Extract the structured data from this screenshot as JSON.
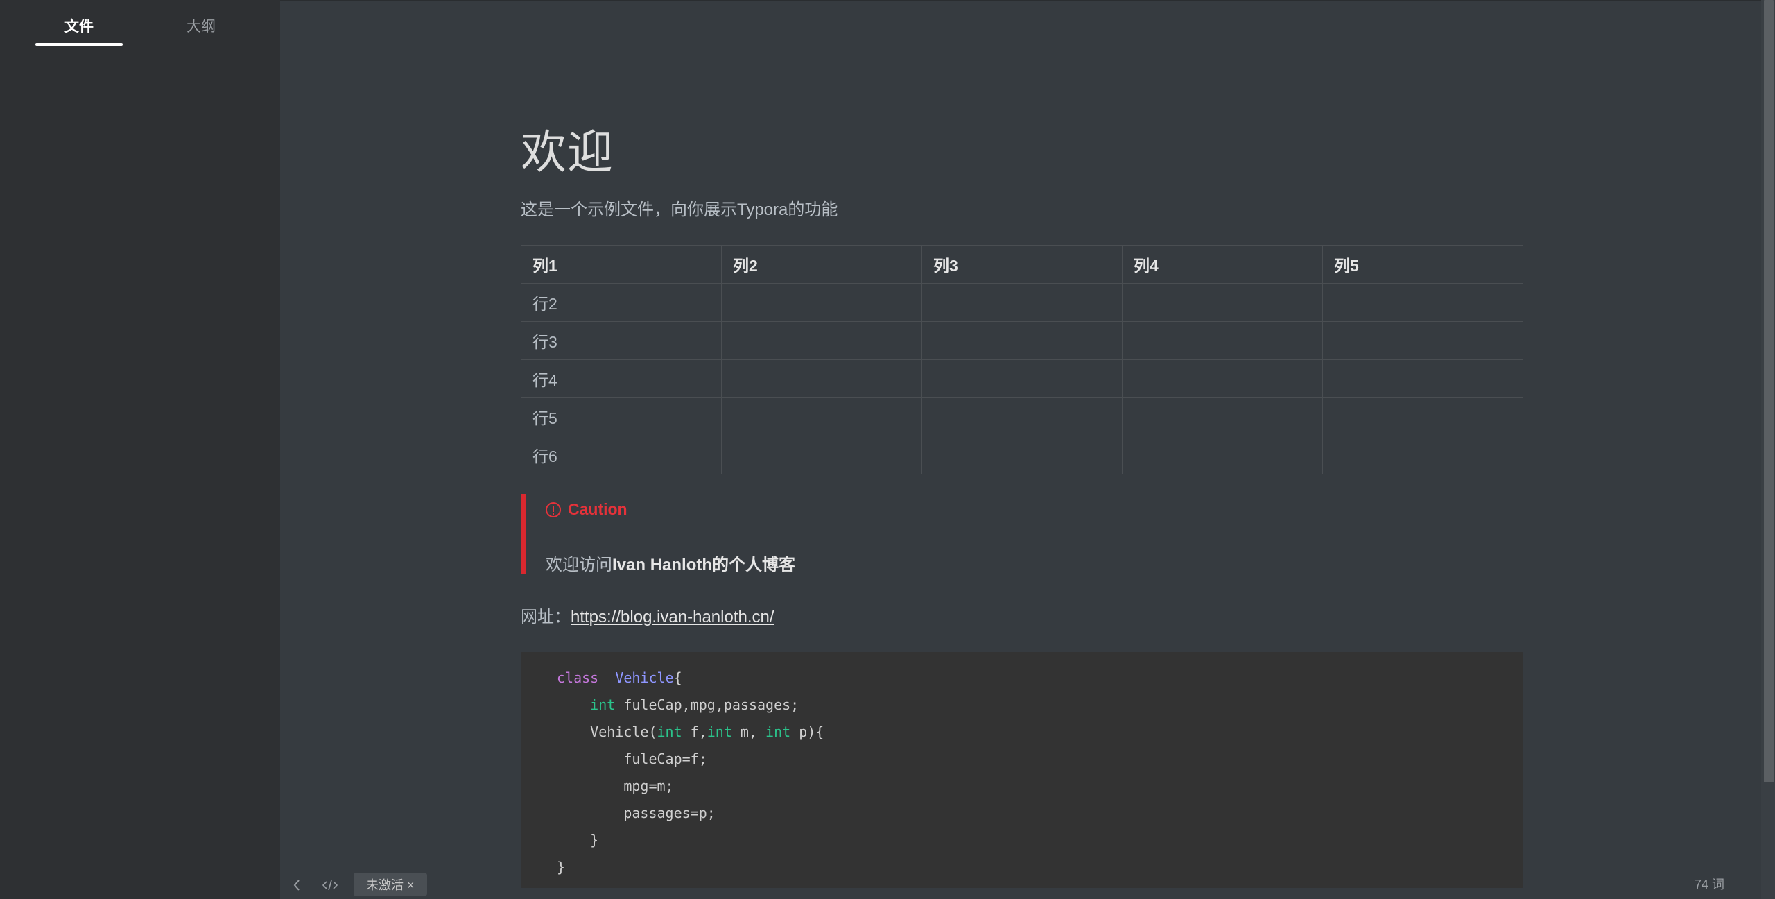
{
  "sidebar": {
    "tabs": [
      {
        "label": "文件",
        "active": true
      },
      {
        "label": "大纲",
        "active": false
      }
    ]
  },
  "document": {
    "heading": "欢迎",
    "intro": "这是一个示例文件，向你展示Typora的功能",
    "table": {
      "headers": [
        "列1",
        "列2",
        "列3",
        "列4",
        "列5"
      ],
      "rows": [
        [
          "行2",
          "",
          "",
          "",
          ""
        ],
        [
          "行3",
          "",
          "",
          "",
          ""
        ],
        [
          "行4",
          "",
          "",
          "",
          ""
        ],
        [
          "行5",
          "",
          "",
          "",
          ""
        ],
        [
          "行6",
          "",
          "",
          "",
          ""
        ]
      ]
    },
    "caution": {
      "title": "Caution",
      "icon": "alert-circle-icon",
      "body_prefix": "欢迎访问",
      "body_bold": "Ivan Hanloth的个人博客"
    },
    "url": {
      "label": "网址：",
      "link": "https://blog.ivan-hanloth.cn/"
    },
    "code": [
      [
        [
          "kw",
          "class"
        ],
        [
          "",
          "  "
        ],
        [
          "cls",
          "Vehicle"
        ],
        [
          "",
          "{"
        ]
      ],
      [
        [
          "",
          "    "
        ],
        [
          "ty",
          "int"
        ],
        [
          "",
          " fuleCap,mpg,passages;"
        ]
      ],
      [
        [
          "",
          "    Vehicle("
        ],
        [
          "ty",
          "int"
        ],
        [
          "",
          " f,"
        ],
        [
          "ty",
          "int"
        ],
        [
          "",
          " m, "
        ],
        [
          "ty",
          "int"
        ],
        [
          "",
          " p){"
        ]
      ],
      [
        [
          "",
          "        fuleCap=f;"
        ]
      ],
      [
        [
          "",
          "        mpg=m;"
        ]
      ],
      [
        [
          "",
          "        passages=p;"
        ]
      ],
      [
        [
          "",
          "    }"
        ]
      ],
      [
        [
          "",
          "}"
        ]
      ]
    ]
  },
  "footer": {
    "back_icon": "chevron-left-icon",
    "source_icon": "code-icon",
    "badge": "未激活 ×",
    "word_count": "74 词"
  },
  "colors": {
    "background": "#363b40",
    "sidebar": "#2e3033",
    "caution": "#e5323a",
    "code_bg": "#333333"
  }
}
